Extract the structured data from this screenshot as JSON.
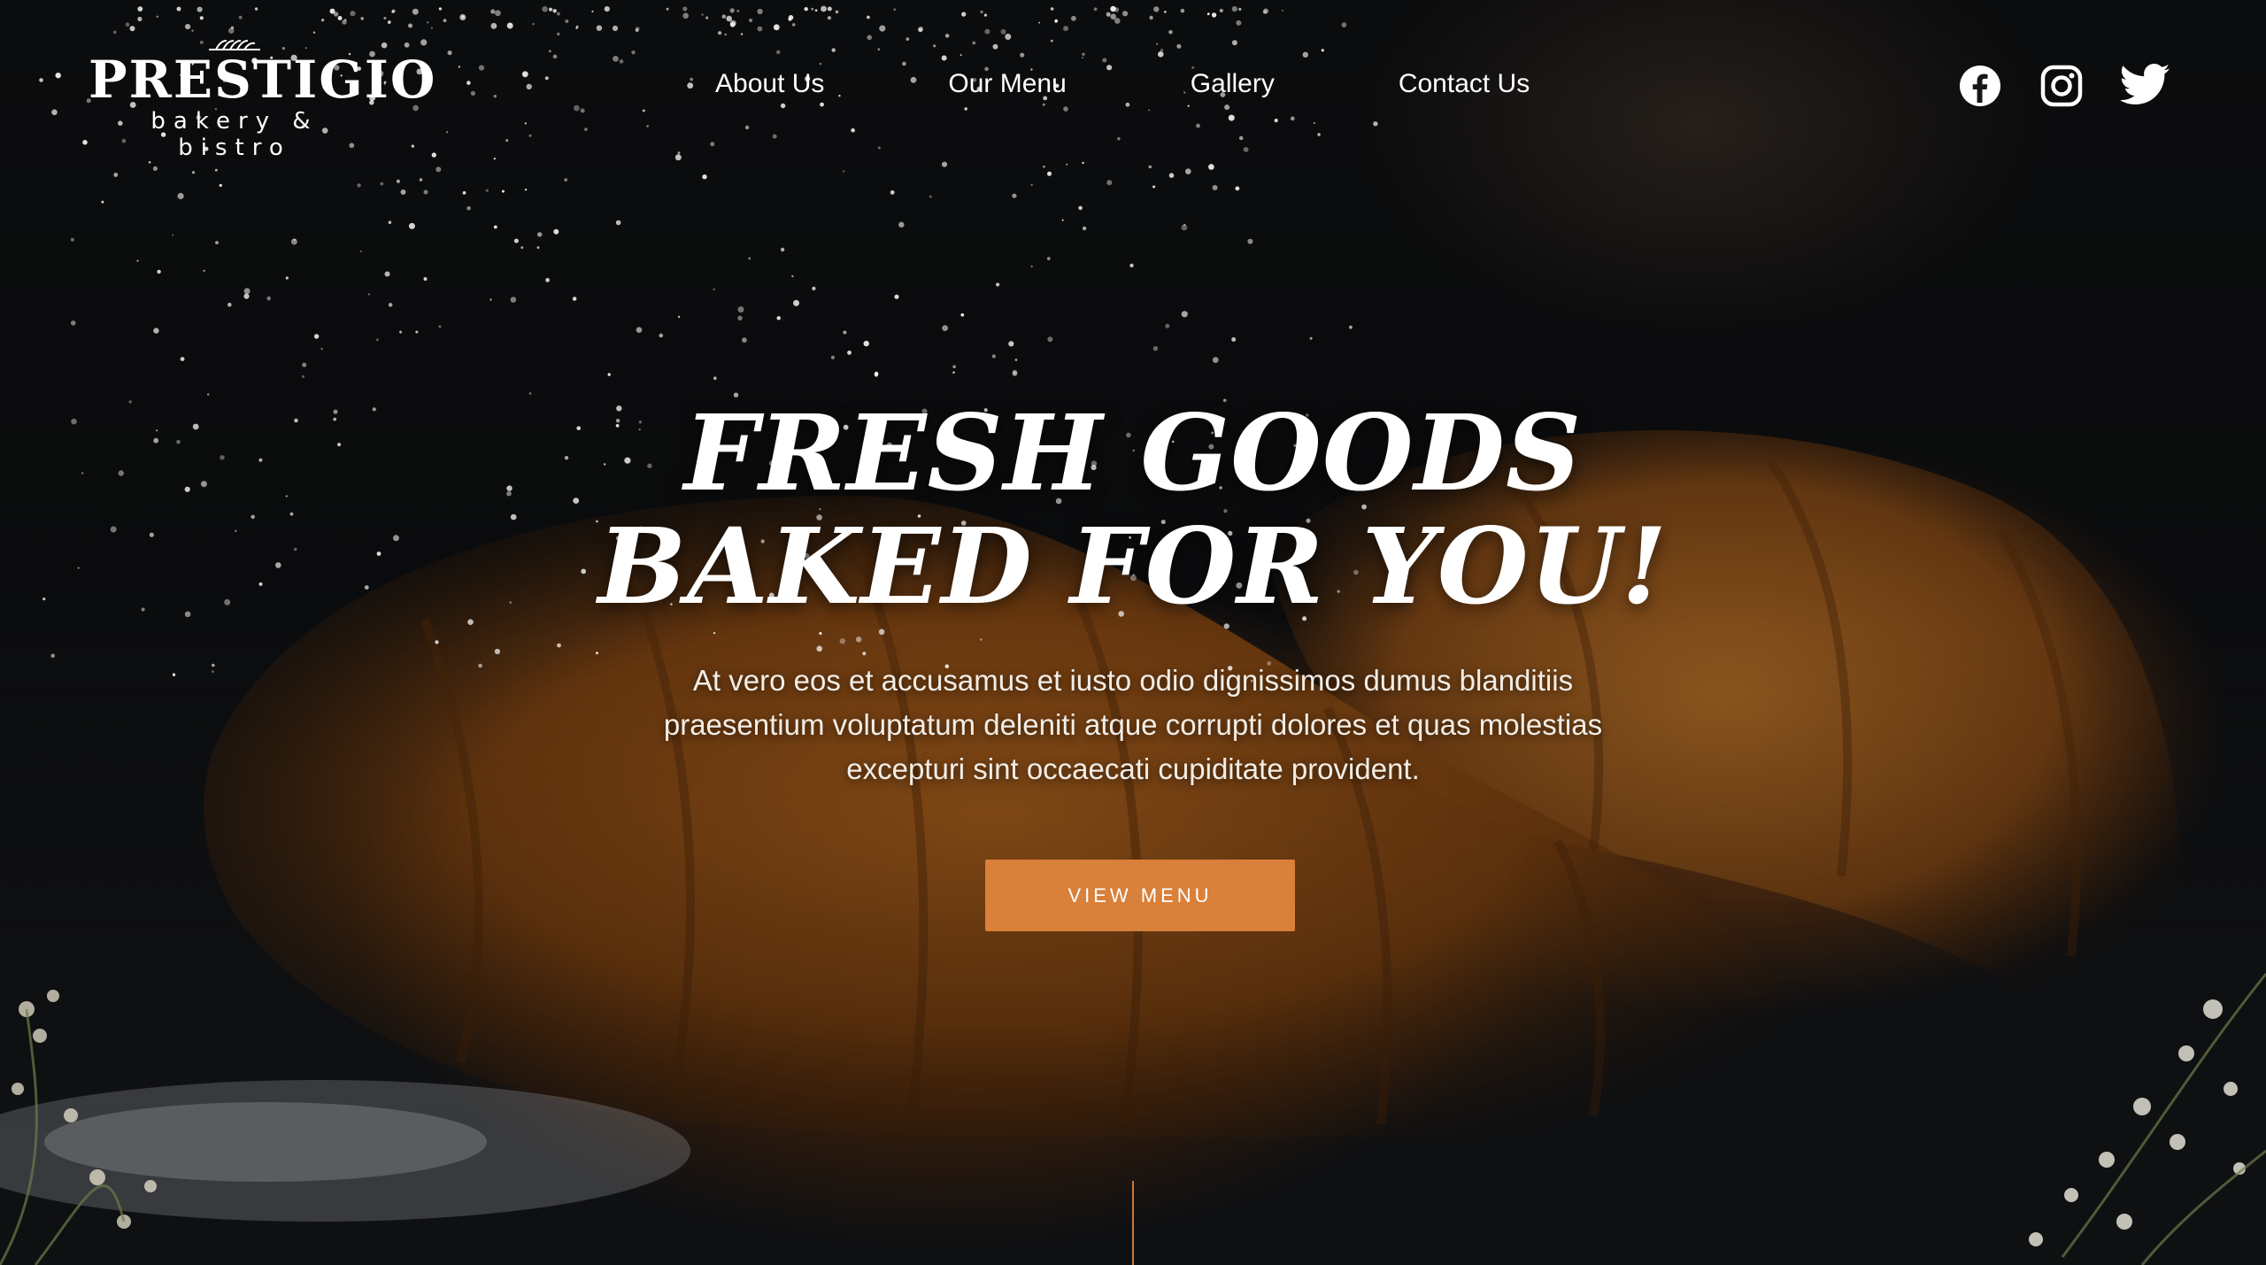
{
  "brand": {
    "name": "PRESTIGIO",
    "tagline": "bakery & bistro",
    "logo_icon": "wheat-icon"
  },
  "nav": {
    "items": [
      {
        "label": "About Us"
      },
      {
        "label": "Our Menu"
      },
      {
        "label": "Gallery"
      },
      {
        "label": "Contact Us"
      }
    ]
  },
  "social": {
    "icons": [
      "facebook-icon",
      "instagram-icon",
      "twitter-icon"
    ]
  },
  "hero": {
    "headline_line1": "FRESH GOODS",
    "headline_line2": "BAKED FOR YOU!",
    "body": "At vero eos et accusamus et iusto odio dignissimos dumus blanditiis praesentium voluptatum deleniti atque corrupti dolores et quas molestias excepturi sint occaecati cupiditate provident.",
    "cta_label": "VIEW MENU"
  },
  "colors": {
    "accent": "#d9803a",
    "text": "#ffffff",
    "background": "#0e0f11"
  }
}
